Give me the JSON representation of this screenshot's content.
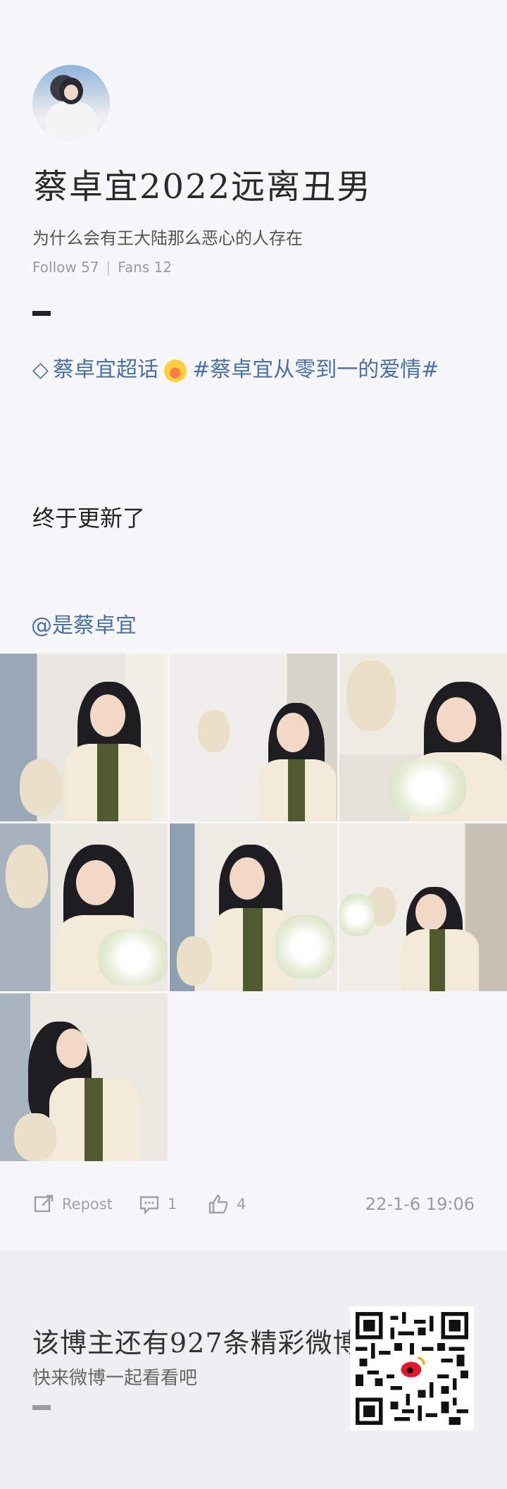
{
  "profile": {
    "nickname": "蔡卓宜2022远离丑男",
    "bio": "为什么会有王大陆那么恶心的人存在",
    "follow": "Follow 57",
    "fans": "Fans 12",
    "separator": "|"
  },
  "post": {
    "topic_gem": "◇",
    "topic_super": "蔡卓宜超话",
    "topic_hashtag": "#蔡卓宜从零到一的爱情#",
    "text": "终于更新了",
    "mention": "@是蔡卓宜",
    "photos_count": 7
  },
  "actions": {
    "repost": "Repost",
    "comments": "1",
    "likes": "4",
    "timestamp": "22-1-6 19:06"
  },
  "footer": {
    "line1": "该博主还有927条精彩微博",
    "line2": "快来微博一起看看吧"
  },
  "watermark": "微博"
}
